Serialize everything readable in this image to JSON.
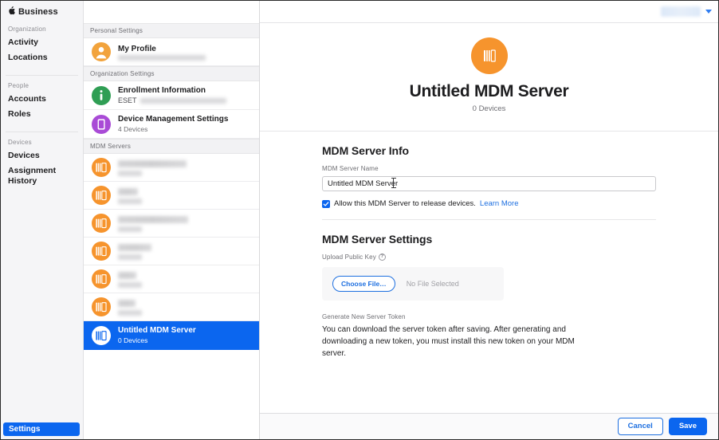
{
  "brand": {
    "apple_glyph": "",
    "name": "Business",
    "icon": "apple-logo-icon"
  },
  "nav": {
    "groups": [
      {
        "title": "Organization",
        "items": [
          {
            "label": "Activity"
          },
          {
            "label": "Locations"
          }
        ]
      },
      {
        "title": "People",
        "items": [
          {
            "label": "Accounts"
          },
          {
            "label": "Roles"
          }
        ]
      },
      {
        "title": "Devices",
        "items": [
          {
            "label": "Devices"
          },
          {
            "label": "Assignment History"
          }
        ]
      }
    ],
    "settings_label": "Settings"
  },
  "list": {
    "sections": [
      {
        "header": "Personal Settings",
        "rows": [
          {
            "title": "My Profile",
            "sub": "",
            "sub_redacted": true,
            "sub_redact_width": 110,
            "icon": "person-circle-icon",
            "icon_color": "#f2a33c",
            "selected": false,
            "title_redacted": false
          }
        ]
      },
      {
        "header": "Organization Settings",
        "rows": [
          {
            "title": "Enrollment Information",
            "sub": "ESET",
            "sub_redacted": true,
            "sub_redact_width": 108,
            "icon": "info-circle-icon",
            "icon_color": "#2f9e54",
            "selected": false,
            "title_redacted": false
          },
          {
            "title": "Device Management Settings",
            "sub": "4 Devices",
            "sub_redacted": false,
            "icon": "device-icon",
            "icon_color": "#a94bd6",
            "selected": false,
            "title_redacted": false
          }
        ]
      },
      {
        "header": "MDM Servers",
        "rows": [
          {
            "title": "",
            "sub": "",
            "title_redacted": true,
            "title_redact_width": 86,
            "sub_redacted": true,
            "sub_redact_width": 30,
            "icon": "mdm-server-icon",
            "icon_color": "#f6942d",
            "selected": false
          },
          {
            "title": "",
            "sub": "",
            "title_redacted": true,
            "title_redact_width": 25,
            "sub_redacted": true,
            "sub_redact_width": 30,
            "icon": "mdm-server-icon",
            "icon_color": "#f6942d",
            "selected": false
          },
          {
            "title": "",
            "sub": "",
            "title_redacted": true,
            "title_redact_width": 88,
            "sub_redacted": true,
            "sub_redact_width": 30,
            "icon": "mdm-server-icon",
            "icon_color": "#f6942d",
            "selected": false
          },
          {
            "title": "",
            "sub": "",
            "title_redacted": true,
            "title_redact_width": 42,
            "sub_redacted": true,
            "sub_redact_width": 30,
            "icon": "mdm-server-icon",
            "icon_color": "#f6942d",
            "selected": false
          },
          {
            "title": "",
            "sub": "",
            "title_redacted": true,
            "title_redact_width": 23,
            "sub_redacted": true,
            "sub_redact_width": 30,
            "icon": "mdm-server-icon",
            "icon_color": "#f6942d",
            "selected": false
          },
          {
            "title": "",
            "sub": "",
            "title_redacted": true,
            "title_redact_width": 22,
            "sub_redacted": true,
            "sub_redact_width": 30,
            "icon": "mdm-server-icon",
            "icon_color": "#f6942d",
            "selected": false
          },
          {
            "title": "Untitled MDM Server",
            "sub": "0 Devices",
            "title_redacted": false,
            "sub_redacted": false,
            "icon": "mdm-server-icon",
            "icon_color": "#ffffff",
            "selected": true
          }
        ]
      }
    ]
  },
  "detail": {
    "topbar": {
      "account_menu_redacted": true,
      "chevron_icon": "chevron-down-icon"
    },
    "hero": {
      "icon": "mdm-server-icon",
      "icon_bg": "#f6942d",
      "title": "Untitled MDM Server",
      "subtitle": "0 Devices"
    },
    "info_section": {
      "title": "MDM Server Info",
      "name_label": "MDM Server Name",
      "name_value": "Untitled MDM Server",
      "name_placeholder": "MDM Server Name",
      "checkbox_checked": true,
      "checkbox_label": "Allow this MDM Server to release devices.",
      "learn_more": "Learn More"
    },
    "settings_section": {
      "title": "MDM Server Settings",
      "upload_label": "Upload Public Key",
      "help_icon": "question-mark-icon",
      "choose_file_label": "Choose File…",
      "no_file_text": "No File Selected",
      "token_label": "Generate New Server Token",
      "token_text": "You can download the server token after saving. After generating and downloading a new token, you must install this new token on your MDM server."
    },
    "footer": {
      "cancel_label": "Cancel",
      "save_label": "Save"
    }
  },
  "colors": {
    "accent_blue": "#0b66ef",
    "link_blue": "#1d6fe0",
    "orange": "#f6942d",
    "green": "#2f9e54",
    "purple": "#a94bd6",
    "amber": "#f2a33c"
  }
}
